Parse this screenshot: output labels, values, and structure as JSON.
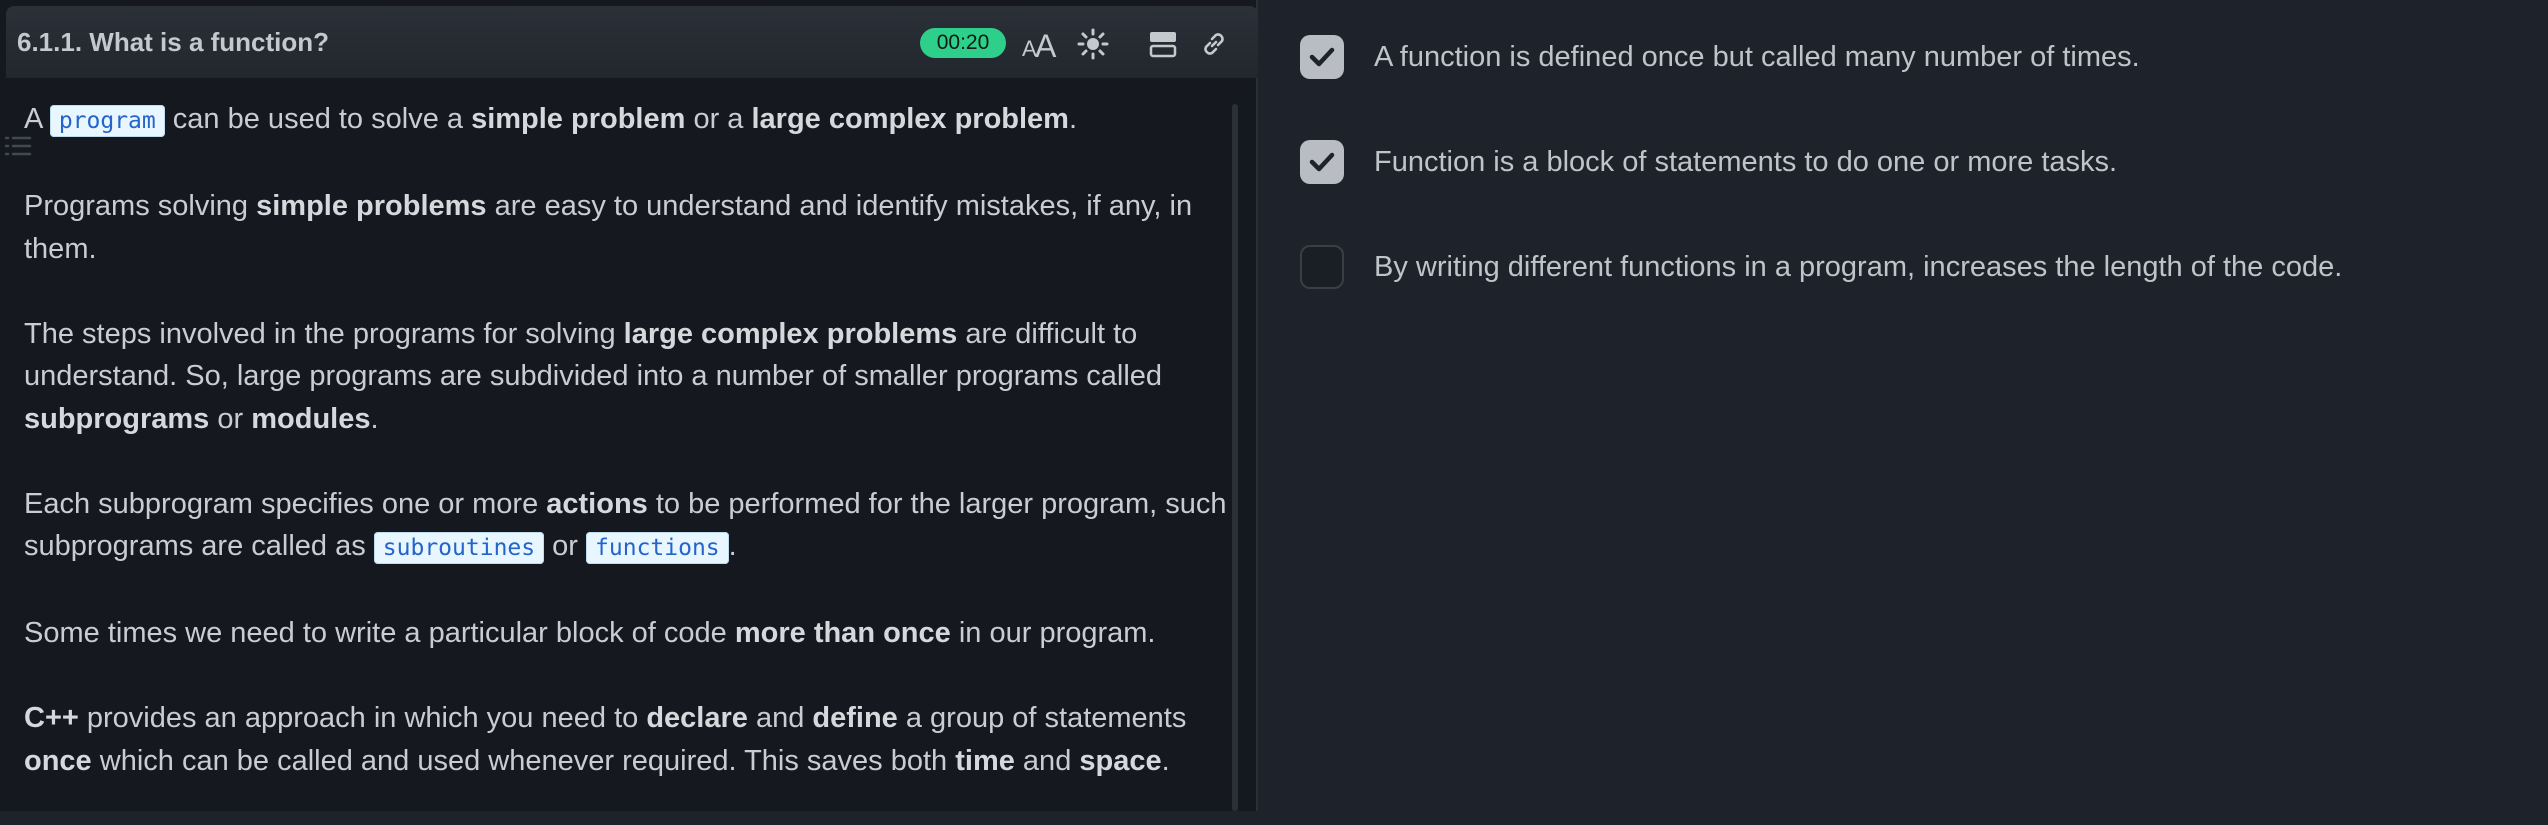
{
  "header": {
    "title": "6.1.1. What is a function?",
    "timer": "00:20",
    "icons": [
      "font-size-icon",
      "brightness-icon",
      "layout-icon",
      "link-icon"
    ]
  },
  "content": {
    "p1": {
      "a": "A ",
      "code1": "program",
      "b": " can be used to solve a ",
      "bold1": "simple problem",
      "c": " or a ",
      "bold2": "large complex problem",
      "d": "."
    },
    "p2": {
      "a": "Programs solving ",
      "bold1": "simple problems",
      "b": " are easy to understand and identify mistakes, if any, in them."
    },
    "p3": {
      "a": "The steps involved in the programs for solving ",
      "bold1": "large complex problems",
      "b": " are difficult to understand. So, large programs are subdivided into a number of smaller programs called ",
      "bold2": "subprograms",
      "c": " or ",
      "bold3": "modules",
      "d": "."
    },
    "p4": {
      "a": "Each subprogram specifies one or more ",
      "bold1": "actions",
      "b": " to be performed for the larger program, such subprograms are called as ",
      "code1": "subroutines",
      "c": " or ",
      "code2": "functions",
      "d": "."
    },
    "p5": {
      "a": "Some times we need to write a particular block of code ",
      "bold1": "more than once",
      "b": " in our program."
    },
    "p6": {
      "bold1": "C++",
      "a": " provides an approach in which you need to ",
      "bold2": "declare",
      "b": " and ",
      "bold3": "define",
      "c": " a group of statements ",
      "bold4": "once",
      "d": " which can be called and used whenever required. This saves both ",
      "bold5": "time",
      "e": " and ",
      "bold6": "space",
      "f": "."
    }
  },
  "options": [
    {
      "text": "A function is defined once but called many number of times.",
      "checked": true
    },
    {
      "text": "Function is a block of statements to do one or more tasks.",
      "checked": true
    },
    {
      "text": "By writing different functions in a program, increases the length of the code.",
      "checked": false
    }
  ],
  "colors": {
    "timer_badge": "#2ecf8a",
    "code_bg": "#e8f6ff",
    "code_text": "#2564c8",
    "checkbox_checked": "#b9bdc3"
  }
}
